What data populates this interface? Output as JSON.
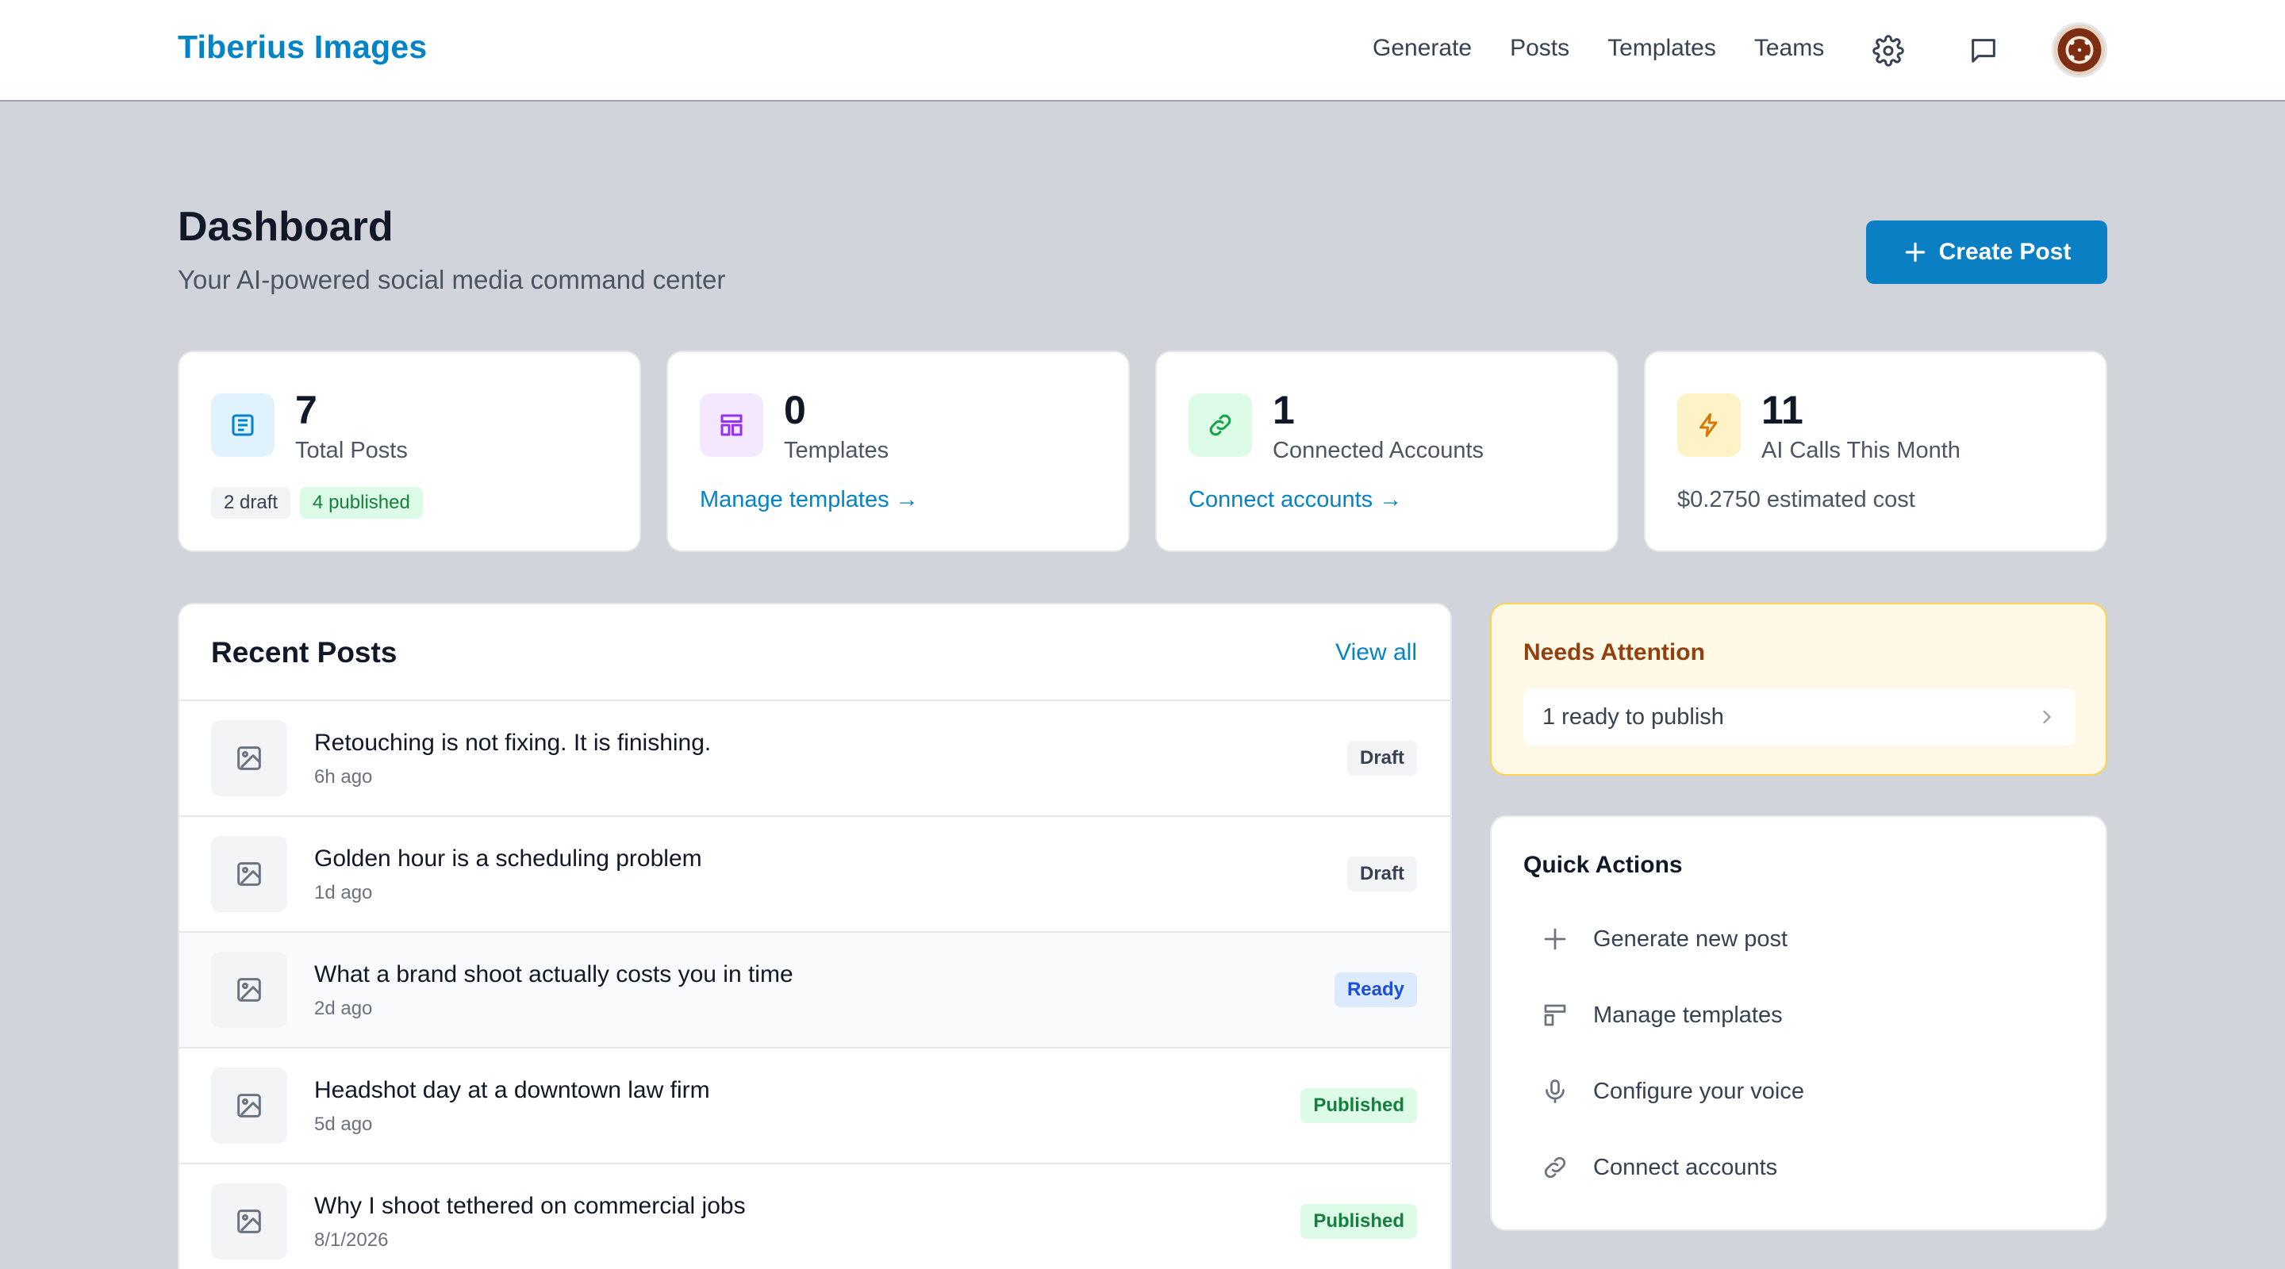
{
  "header": {
    "brand": "Tiberius Images",
    "nav": [
      "Generate",
      "Posts",
      "Templates",
      "Teams"
    ]
  },
  "page": {
    "title": "Dashboard",
    "subtitle": "Your AI-powered social media command center",
    "create_label": "Create Post"
  },
  "stats": {
    "posts": {
      "value": "7",
      "label": "Total Posts",
      "draft_badge": "2 draft",
      "published_badge": "4 published"
    },
    "templates": {
      "value": "0",
      "label": "Templates",
      "link": "Manage templates →"
    },
    "accounts": {
      "value": "1",
      "label": "Connected Accounts",
      "link": "Connect accounts →"
    },
    "ai": {
      "value": "11",
      "label": "AI Calls This Month",
      "meta": "$0.2750 estimated cost"
    }
  },
  "recent": {
    "title": "Recent Posts",
    "view_all": "View all",
    "posts": [
      {
        "title": "Retouching is not fixing. It is finishing.",
        "time": "6h ago",
        "status": "Draft"
      },
      {
        "title": "Golden hour is a scheduling problem",
        "time": "1d ago",
        "status": "Draft"
      },
      {
        "title": "What a brand shoot actually costs you in time",
        "time": "2d ago",
        "status": "Ready"
      },
      {
        "title": "Headshot day at a downtown law firm",
        "time": "5d ago",
        "status": "Published"
      },
      {
        "title": "Why I shoot tethered on commercial jobs",
        "time": "8/1/2026",
        "status": "Published"
      }
    ]
  },
  "attention": {
    "title": "Needs Attention",
    "item": "1 ready to publish"
  },
  "quick": {
    "title": "Quick Actions",
    "items": [
      "Generate new post",
      "Manage templates",
      "Configure your voice",
      "Connect accounts"
    ]
  },
  "colors": {
    "brand": "#0284c7",
    "primary_button": "#0b7fc4",
    "background": "#d1d5db",
    "attention_bg": "#fef9e7"
  }
}
